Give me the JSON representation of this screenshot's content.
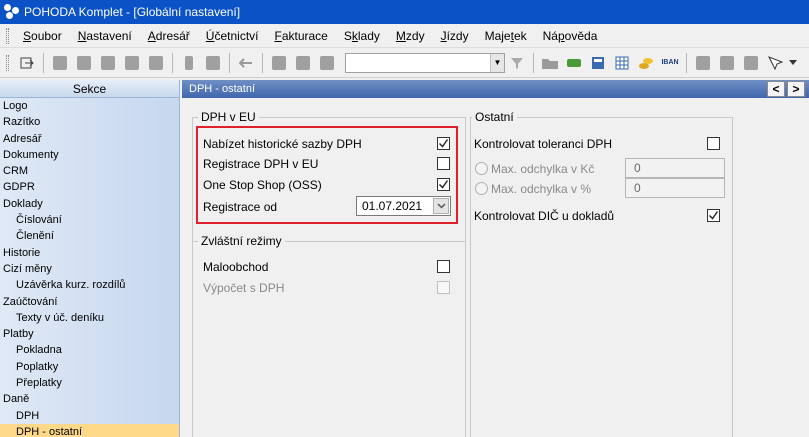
{
  "window": {
    "title": "POHODA Komplet - [Globální nastavení]"
  },
  "menu": [
    {
      "label": "Soubor",
      "accel": "S"
    },
    {
      "label": "Nastavení",
      "accel": "N"
    },
    {
      "label": "Adresář",
      "accel": "A"
    },
    {
      "label": "Účetnictví",
      "accel": "Ú"
    },
    {
      "label": "Fakturace",
      "accel": "F"
    },
    {
      "label": "Sklady",
      "accel": "k"
    },
    {
      "label": "Mzdy",
      "accel": "M"
    },
    {
      "label": "Jízdy",
      "accel": "J"
    },
    {
      "label": "Majetek",
      "accel": "t"
    },
    {
      "label": "Nápověda",
      "accel": "p"
    }
  ],
  "toolbar": {
    "combo_value": "",
    "iban_label": "IBAN"
  },
  "sidebar": {
    "header": "Sekce",
    "items": [
      {
        "label": "Logo",
        "level": 1
      },
      {
        "label": "Razítko",
        "level": 1
      },
      {
        "label": "Adresář",
        "level": 1
      },
      {
        "label": "Dokumenty",
        "level": 1
      },
      {
        "label": "CRM",
        "level": 1
      },
      {
        "label": "GDPR",
        "level": 1
      },
      {
        "label": "Doklady",
        "level": 1
      },
      {
        "label": "Číslování",
        "level": 2
      },
      {
        "label": "Členění",
        "level": 2
      },
      {
        "label": "Historie",
        "level": 1
      },
      {
        "label": "Cizí měny",
        "level": 1
      },
      {
        "label": "Uzávěrka kurz. rozdílů",
        "level": 2
      },
      {
        "label": "Zaúčtování",
        "level": 1
      },
      {
        "label": "Texty v úč. deníku",
        "level": 2
      },
      {
        "label": "Platby",
        "level": 1
      },
      {
        "label": "Pokladna",
        "level": 2
      },
      {
        "label": "Poplatky",
        "level": 2
      },
      {
        "label": "Přeplatky",
        "level": 2
      },
      {
        "label": "Daně",
        "level": 1
      },
      {
        "label": "DPH",
        "level": 2
      },
      {
        "label": "DPH - ostatní",
        "level": 2,
        "active": true
      }
    ]
  },
  "panel": {
    "title": "DPH - ostatní",
    "nav_prev": "<",
    "nav_next": ">",
    "dph_eu": {
      "title": "DPH v EU",
      "historic_rates": {
        "label": "Nabízet historické sazby DPH",
        "checked": true
      },
      "registration_eu": {
        "label": "Registrace DPH v EU",
        "checked": false
      },
      "oss": {
        "label": "One Stop Shop (OSS)",
        "checked": true
      },
      "registration_from": {
        "label": "Registrace od",
        "value": "01.07.2021"
      }
    },
    "special": {
      "title": "Zvláštní režimy",
      "retail": {
        "label": "Maloobchod",
        "checked": false
      },
      "vat_calc": {
        "label": "Výpočet s DPH",
        "checked": false,
        "disabled": true
      }
    },
    "other": {
      "title": "Ostatní",
      "tolerance": {
        "label": "Kontrolovat toleranci DPH",
        "checked": false
      },
      "max_kc": {
        "label": "Max. odchylka v Kč",
        "value": "0"
      },
      "max_pct": {
        "label": "Max. odchylka v %",
        "value": "0"
      },
      "dic": {
        "label": "Kontrolovat DIČ u dokladů",
        "checked": true
      }
    }
  },
  "colors": {
    "title_bar": "#0a52c6",
    "panel_header": "#3f66ad",
    "highlight": "#e0202a",
    "active_item": "#ffd98a"
  }
}
